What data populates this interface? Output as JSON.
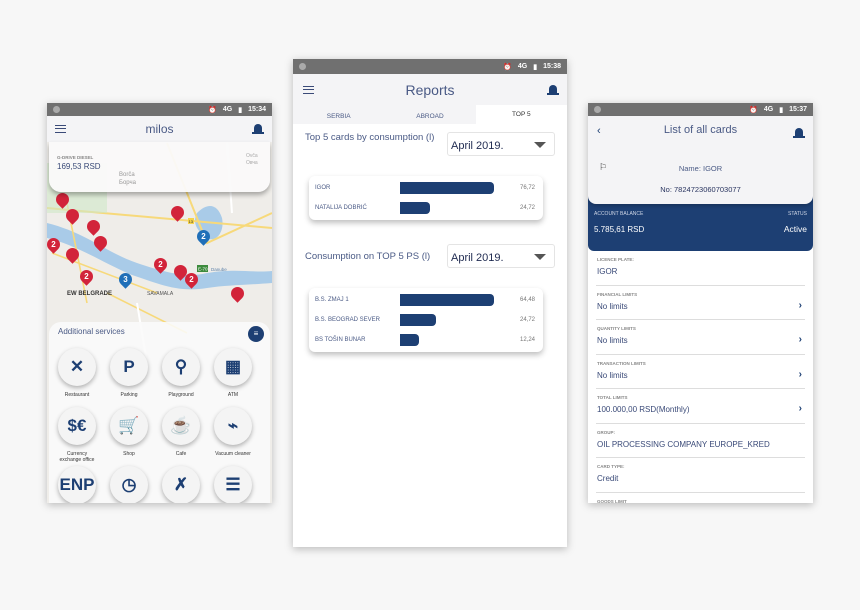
{
  "colors": {
    "primary": "#1d3f73",
    "pin_red": "#d2243a",
    "pin_blue": "#1f6fb8",
    "status_bar": "#707070"
  },
  "phone1": {
    "status": {
      "network": "4G",
      "time": "15:34"
    },
    "header": {
      "title": "milos",
      "menu_icon": "hamburger-icon",
      "bell_icon": "bell-icon"
    },
    "fuel_card": {
      "label": "G-DRIVE DIESEL",
      "price": "169,53 RSD"
    },
    "map_labels": [
      "Borča",
      "Борча",
      "Ovča",
      "Овча",
      "EW BELGRADE",
      "SAVAMALA",
      "E-70",
      "Danube",
      "13",
      "4"
    ],
    "pins": [
      "",
      "",
      "",
      "2",
      "",
      "",
      "2",
      "",
      "2",
      "3",
      "2",
      "",
      "2",
      ""
    ],
    "services": {
      "title": "Additional services",
      "filter_icon": "filter-icon",
      "items": [
        {
          "label": "Restaurant",
          "icon": "fork-knife-icon",
          "glyph": "✕"
        },
        {
          "label": "Parking",
          "icon": "parking-icon",
          "glyph": "P"
        },
        {
          "label": "Playground",
          "icon": "swing-icon",
          "glyph": "⚲"
        },
        {
          "label": "ATM",
          "icon": "atm-icon",
          "glyph": "▦"
        },
        {
          "label": "Currency exchange office",
          "icon": "currency-exchange-icon",
          "glyph": "$€"
        },
        {
          "label": "Shop",
          "icon": "cart-icon",
          "glyph": "🛒"
        },
        {
          "label": "Cafe",
          "icon": "coffee-icon",
          "glyph": "☕"
        },
        {
          "label": "Vacuum cleaner",
          "icon": "vacuum-icon",
          "glyph": "⌁"
        },
        {
          "label": "",
          "icon": "enp-icon",
          "glyph": "ENP"
        },
        {
          "label": "",
          "icon": "clock-icon",
          "glyph": "◷"
        },
        {
          "label": "",
          "icon": "wrench-icon",
          "glyph": "✗"
        },
        {
          "label": "",
          "icon": "bench-icon",
          "glyph": "☰"
        }
      ]
    }
  },
  "phone2": {
    "status": {
      "network": "4G",
      "time": "15:38"
    },
    "header": {
      "title": "Reports"
    },
    "tabs": [
      "SERBIA",
      "ABROAD",
      "TOP 5"
    ],
    "active_tab": "TOP 5",
    "chart_data": [
      {
        "type": "bar",
        "title": "Top 5 cards by consumption (l)",
        "period": "April 2019.",
        "categories": [
          "IGOR",
          "NATALIJA DOBRIĆ"
        ],
        "values": [
          76.72,
          24.72
        ],
        "labels": [
          "76,72",
          "24,72"
        ]
      },
      {
        "type": "bar",
        "title": "Consumption on TOP 5 PS (l)",
        "period": "April 2019.",
        "categories": [
          "B.S. ZMAJ 1",
          "B.S. BEOGRAD SEVER",
          "BS TOŠIN BUNAR"
        ],
        "values": [
          64.48,
          24.72,
          12.24
        ],
        "labels": [
          "64,48",
          "24,72",
          "12,24"
        ]
      }
    ]
  },
  "phone3": {
    "status": {
      "network": "4G",
      "time": "15:37"
    },
    "header": {
      "title": "List of all cards"
    },
    "card": {
      "name": "Name: IGOR",
      "number": "No: 7824723060703077"
    },
    "balance": {
      "label": "ACCOUNT BALANCE",
      "value": "5.785,61 RSD",
      "status_label": "STATUS",
      "status": "Active"
    },
    "fields": [
      {
        "label": "LICENCE PLATE:",
        "value": "IGOR",
        "chevron": false
      },
      {
        "label": "FINANCIAL LIMITS",
        "value": "No limits",
        "chevron": true
      },
      {
        "label": "QUANTITY LIMITS",
        "value": "No limits",
        "chevron": true
      },
      {
        "label": "TRANSACTION LIMITS",
        "value": "No limits",
        "chevron": true
      },
      {
        "label": "TOTAL LIMITS",
        "value": "100.000,00 RSD(Monthly)",
        "chevron": true
      },
      {
        "label": "GROUP:",
        "value": "OIL PROCESSING COMPANY EUROPE_KRED",
        "chevron": false
      },
      {
        "label": "CARD TYPE:",
        "value": "Credit",
        "chevron": false
      },
      {
        "label": "GOODS LIMIT",
        "value": "",
        "chevron": false
      }
    ]
  }
}
